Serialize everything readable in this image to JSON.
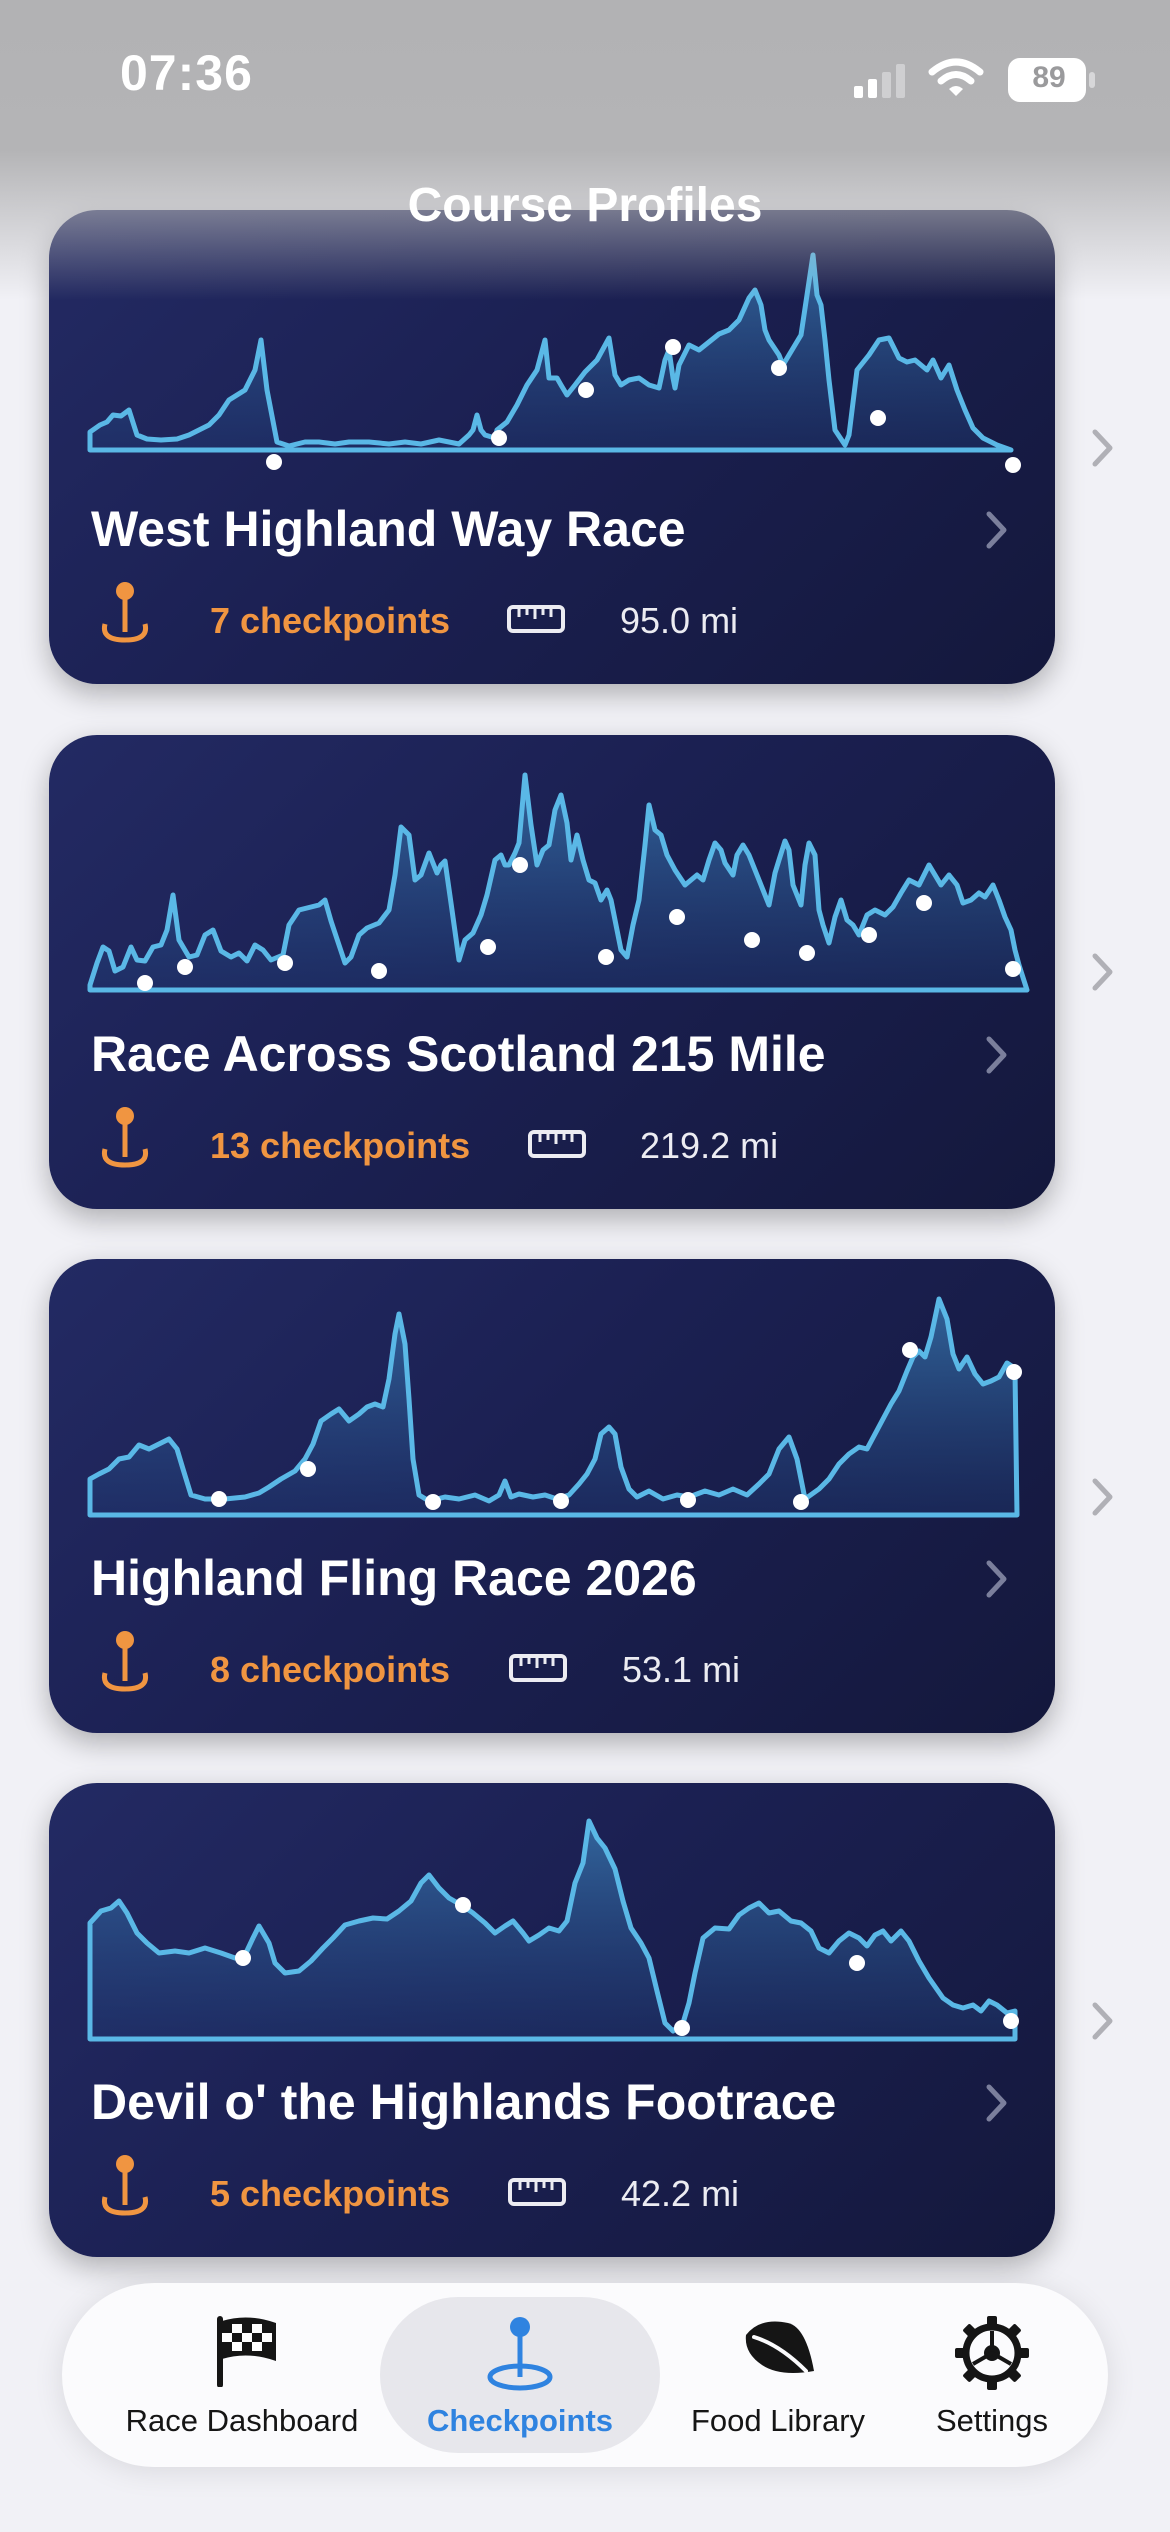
{
  "status_bar": {
    "time": "07:36",
    "battery": "89"
  },
  "header": {
    "title": "Course Profiles"
  },
  "courses": [
    {
      "name": "West Highland Way Race",
      "checkpoints": "7 checkpoints",
      "distance": "95.0 mi"
    },
    {
      "name": "Race Across Scotland 215 Mile",
      "checkpoints": "13 checkpoints",
      "distance": "219.2 mi"
    },
    {
      "name": "Highland Fling Race 2026",
      "checkpoints": "8 checkpoints",
      "distance": "53.1 mi"
    },
    {
      "name": "Devil o' the Highlands Footrace",
      "checkpoints": "5 checkpoints",
      "distance": "42.2 mi"
    }
  ],
  "tab_bar": {
    "tabs": [
      {
        "label": "Race Dashboard",
        "icon": "checkered-flag-icon"
      },
      {
        "label": "Checkpoints",
        "icon": "map-pin-icon",
        "active": true
      },
      {
        "label": "Food Library",
        "icon": "leaf-icon"
      },
      {
        "label": "Settings",
        "icon": "gear-icon"
      }
    ]
  },
  "colors": {
    "accent": "#f09541",
    "profile_line": "#5ab8e6",
    "card_background": "#1b2052",
    "active_tab": "#2f83e0"
  }
}
